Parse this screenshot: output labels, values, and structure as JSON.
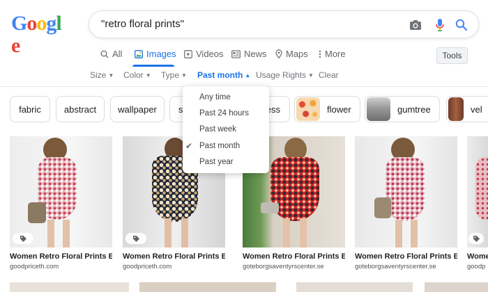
{
  "logo": {
    "text": "Google"
  },
  "search": {
    "query": "\"retro floral prints\""
  },
  "icons": {
    "camera": "camera-icon",
    "mic": "mic-icon",
    "search": "search-icon"
  },
  "tabs": [
    {
      "label": "All",
      "icon": "search-icon"
    },
    {
      "label": "Images",
      "icon": "image-icon",
      "active": true
    },
    {
      "label": "Videos",
      "icon": "play-icon"
    },
    {
      "label": "News",
      "icon": "news-icon"
    },
    {
      "label": "Maps",
      "icon": "map-pin-icon"
    },
    {
      "label": "More",
      "icon": "more-vert-icon"
    }
  ],
  "tools_label": "Tools",
  "filters": [
    {
      "label": "Size"
    },
    {
      "label": "Color"
    },
    {
      "label": "Type"
    },
    {
      "label": "Past month",
      "active": true
    },
    {
      "label": "Usage Rights"
    },
    {
      "label": "Clear"
    }
  ],
  "chips": [
    {
      "label": "fabric"
    },
    {
      "label": "abstract"
    },
    {
      "label": "wallpaper"
    },
    {
      "label": "s"
    },
    {
      "label": "ess"
    },
    {
      "label": "flower"
    },
    {
      "label": "gumtree"
    },
    {
      "label": "vel"
    }
  ],
  "dropdown": {
    "items": [
      {
        "label": "Any time"
      },
      {
        "label": "Past 24 hours"
      },
      {
        "label": "Past week"
      },
      {
        "label": "Past month",
        "selected": true
      },
      {
        "label": "Past year"
      }
    ]
  },
  "results": [
    {
      "title": "Women Retro Floral Prints El...",
      "source": "goodpriceth.com"
    },
    {
      "title": "Women Retro Floral Prints Elas...",
      "source": "goodpriceth.com"
    },
    {
      "title": "Women Retro Floral Prints El...",
      "source": "goteborgsaventyrscenter.se"
    },
    {
      "title": "Women Retro Floral Prints El...",
      "source": "goteborgsaventyrscenter.se"
    },
    {
      "title": "Wome",
      "source": "goodp"
    }
  ],
  "colors": {
    "accent": "#1a73e8",
    "muted": "#70757a"
  }
}
